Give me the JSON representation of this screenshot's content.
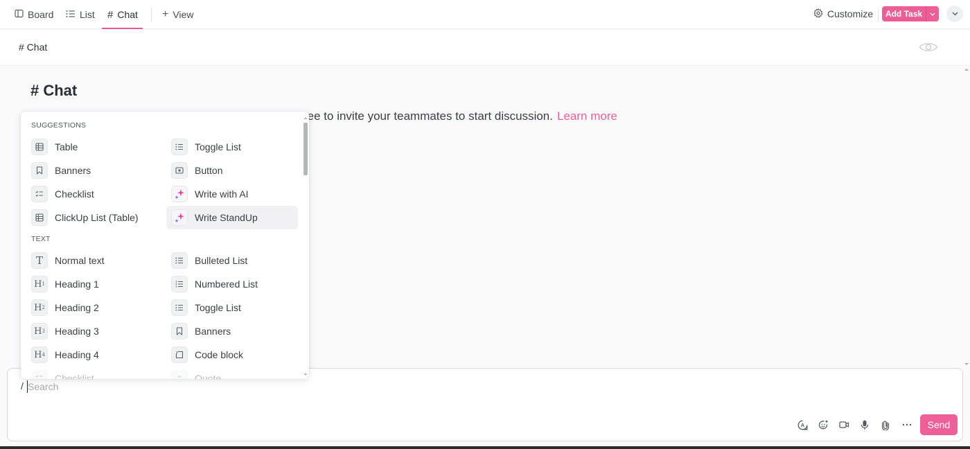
{
  "tabs": [
    {
      "label": "Board",
      "icon": "board-icon"
    },
    {
      "label": "List",
      "icon": "list-icon"
    },
    {
      "label": "Chat",
      "icon": "hash-icon",
      "active": true
    },
    {
      "label": "View",
      "icon": "plus-icon"
    }
  ],
  "toolbar": {
    "customize_label": "Customize",
    "add_task_label": "Add Task"
  },
  "subheader": {
    "title": "# Chat"
  },
  "content": {
    "title": "# Chat",
    "description": "ree to invite your teammates to start discussion.",
    "learn_more": "Learn more"
  },
  "popup": {
    "sections": [
      {
        "label": "SUGGESTIONS",
        "items": [
          {
            "label": "Table",
            "icon": "table-icon"
          },
          {
            "label": "Toggle List",
            "icon": "toggle-list-icon"
          },
          {
            "label": "Banners",
            "icon": "bookmark-icon"
          },
          {
            "label": "Button",
            "icon": "button-icon"
          },
          {
            "label": "Checklist",
            "icon": "checklist-icon"
          },
          {
            "label": "Write with AI",
            "icon": "sparkle-icon"
          },
          {
            "label": "ClickUp List (Table)",
            "icon": "table-icon"
          },
          {
            "label": "Write StandUp",
            "icon": "sparkle-icon",
            "highlighted": true
          }
        ]
      },
      {
        "label": "TEXT",
        "items": [
          {
            "label": "Normal text",
            "icon": "text-icon"
          },
          {
            "label": "Bulleted List",
            "icon": "bulleted-list-icon"
          },
          {
            "label": "Heading 1",
            "icon": "heading-1-icon"
          },
          {
            "label": "Numbered List",
            "icon": "numbered-list-icon"
          },
          {
            "label": "Heading 2",
            "icon": "heading-2-icon"
          },
          {
            "label": "Toggle List",
            "icon": "toggle-list-icon"
          },
          {
            "label": "Heading 3",
            "icon": "heading-3-icon"
          },
          {
            "label": "Banners",
            "icon": "bookmark-icon"
          },
          {
            "label": "Heading 4",
            "icon": "heading-4-icon"
          },
          {
            "label": "Code block",
            "icon": "code-block-icon"
          },
          {
            "label": "Checklist",
            "icon": "checklist-icon"
          },
          {
            "label": "Quote",
            "icon": "quote-icon"
          }
        ]
      }
    ]
  },
  "composer": {
    "prefix": "/",
    "placeholder": "Search",
    "value": "",
    "send_label": "Send",
    "tools": [
      "mention-icon",
      "emoji-icon",
      "video-icon",
      "microphone-icon",
      "attachment-icon",
      "more-icon"
    ]
  },
  "colors": {
    "accent": "#ec5f96",
    "link": "#ee5f98"
  }
}
